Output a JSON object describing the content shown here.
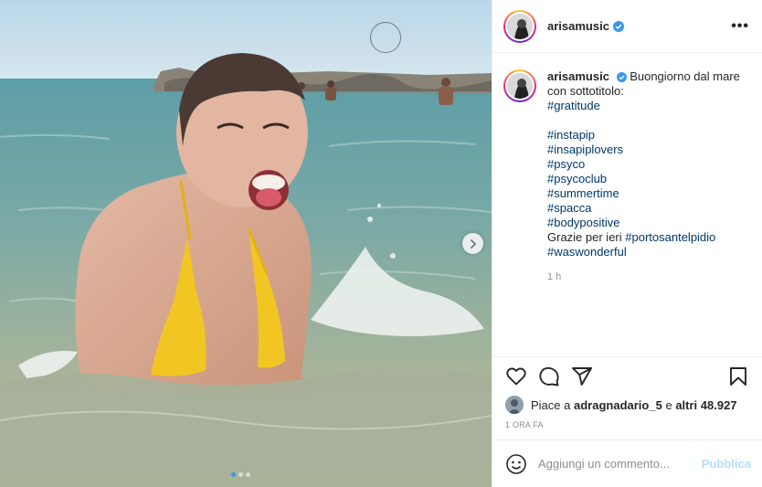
{
  "post": {
    "username": "arisamusic",
    "more_label": "•••",
    "caption": {
      "lead": "Buongiorno dal mare con sottotitolo:",
      "tag_gratitude": "#gratitude",
      "tags": [
        "#instapip",
        "#insapiplovers",
        "#psyco",
        "#psycoclub",
        "#summertime",
        "#spacca",
        "#bodypositive"
      ],
      "thanks_prefix": "Grazie per ieri",
      "tag_porto": "#portosantelpidio",
      "tag_wonderful": "#waswonderful"
    },
    "caption_time": "1 h",
    "likes_prefix": "Piace a",
    "likes_user": "adragnadario_5",
    "likes_middle": "e",
    "likes_others": "altri 48.927",
    "posted_ago": "1 ORA FA",
    "comment_placeholder": "Aggiungi un commento...",
    "publish_label": "Pubblica"
  },
  "colors": {
    "link": "#00376b",
    "verified": "#3897f0",
    "publish_disabled": "#b2dffc",
    "swimsuit": "#f1c623"
  },
  "icons": [
    "heart-icon",
    "comment-icon",
    "share-icon",
    "bookmark-icon",
    "emoji-icon",
    "verified-icon",
    "chevron-right-icon"
  ]
}
